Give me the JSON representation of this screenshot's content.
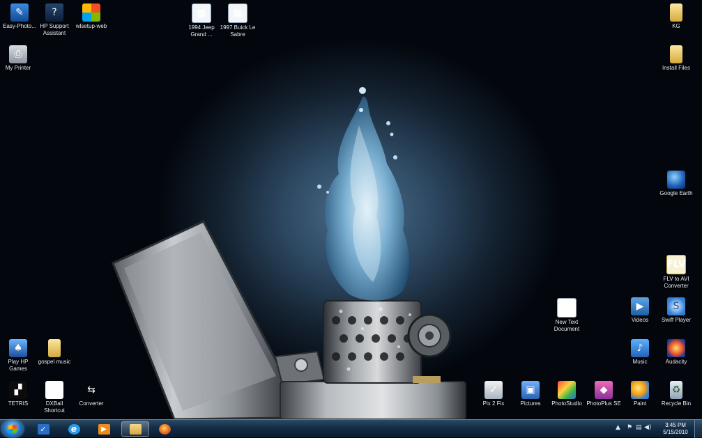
{
  "desktop_icons": [
    {
      "name": "desktop-icon-easy-photo",
      "label": "Easy-Photo...",
      "glyph": "✎",
      "icon": "photo-editor-icon"
    },
    {
      "name": "desktop-icon-hp-support-assistant",
      "label": "HP Support Assistant",
      "glyph": "?",
      "icon": "hp-support-icon"
    },
    {
      "name": "desktop-icon-wlsetup-web",
      "label": "wlsetup-web",
      "glyph": "",
      "icon": "windows-live-icon"
    },
    {
      "name": "desktop-icon-1994-jeep",
      "label": "1994 Jeep Grand ...",
      "glyph": "▦",
      "icon": "spreadsheet-icon"
    },
    {
      "name": "desktop-icon-1997-buick",
      "label": "1997 Buick Le Sabre",
      "glyph": "▦",
      "icon": "spreadsheet-icon"
    },
    {
      "name": "desktop-icon-kg",
      "label": "KG",
      "glyph": "",
      "icon": "folder-icon"
    },
    {
      "name": "desktop-icon-my-printer",
      "label": "My Printer",
      "glyph": "⎙",
      "icon": "printer-icon"
    },
    {
      "name": "desktop-icon-install-files",
      "label": "Install Files",
      "glyph": "",
      "icon": "folder-icon"
    },
    {
      "name": "desktop-icon-google-earth",
      "label": "Google Earth",
      "glyph": "",
      "icon": "globe-icon"
    },
    {
      "name": "desktop-icon-flv-to-avi",
      "label": "FLV to AVI Converter",
      "glyph": "FLV",
      "icon": "flv-converter-icon"
    },
    {
      "name": "desktop-icon-new-text-document",
      "label": "New Text Document",
      "glyph": "≡",
      "icon": "text-document-icon"
    },
    {
      "name": "desktop-icon-videos",
      "label": "Videos",
      "glyph": "▶",
      "icon": "videos-icon"
    },
    {
      "name": "desktop-icon-swiff-player",
      "label": "Swiff Player",
      "glyph": "S",
      "icon": "swiff-player-icon"
    },
    {
      "name": "desktop-icon-play-hp-games",
      "label": "Play HP Games",
      "glyph": "♠",
      "icon": "games-icon"
    },
    {
      "name": "desktop-icon-gospel-music",
      "label": "gospel music",
      "glyph": "",
      "icon": "folder-icon"
    },
    {
      "name": "desktop-icon-music",
      "label": "Music",
      "glyph": "♪",
      "icon": "music-icon"
    },
    {
      "name": "desktop-icon-audacity",
      "label": "Audacity",
      "glyph": "",
      "icon": "audacity-icon"
    },
    {
      "name": "desktop-icon-tetris",
      "label": "TETRIS",
      "glyph": "▞",
      "icon": "tetris-icon"
    },
    {
      "name": "desktop-icon-dxball-shortcut",
      "label": "DXBall Shortcut",
      "glyph": "▤",
      "icon": "dxball-icon"
    },
    {
      "name": "desktop-icon-converter",
      "label": "Converter",
      "glyph": "⇆",
      "icon": "converter-icon"
    },
    {
      "name": "desktop-icon-pix-2-fix",
      "label": "Pix 2 Fix",
      "glyph": "✓",
      "icon": "pix-fix-icon"
    },
    {
      "name": "desktop-icon-pictures",
      "label": "Pictures",
      "glyph": "▣",
      "icon": "pictures-icon"
    },
    {
      "name": "desktop-icon-photostudio",
      "label": "PhotoStudio",
      "glyph": "",
      "icon": "photostudio-icon"
    },
    {
      "name": "desktop-icon-photoplus-se",
      "label": "PhotoPlus SE",
      "glyph": "◆",
      "icon": "photoplus-icon"
    },
    {
      "name": "desktop-icon-paint",
      "label": "Paint",
      "glyph": "",
      "icon": "paint-icon"
    },
    {
      "name": "desktop-icon-recycle-bin",
      "label": "Recycle Bin",
      "glyph": "♻",
      "icon": "recycle-bin-icon"
    }
  ],
  "taskbar": {
    "pinned": [
      {
        "name": "taskbar-hp-support",
        "glyph": "✓",
        "icon": "hp-support-icon",
        "color": "#2b6fc4"
      },
      {
        "name": "taskbar-internet-explorer",
        "glyph": "e",
        "icon": "internet-explorer-icon",
        "color": "#2f9be8"
      },
      {
        "name": "taskbar-media-player",
        "glyph": "▶",
        "icon": "media-player-icon",
        "color": "#f08a1c"
      },
      {
        "name": "taskbar-windows-explorer",
        "glyph": "",
        "icon": "folder-icon",
        "color": "#e9c25a"
      },
      {
        "name": "taskbar-firefox",
        "glyph": "●",
        "icon": "firefox-icon",
        "color": "#e8661f"
      }
    ],
    "tray": {
      "show_hidden_glyph": "▲",
      "action_center_glyph": "⚑",
      "network_glyph": "▤",
      "volume_glyph": "◀)"
    },
    "clock": {
      "time": "3:45 PM",
      "date": "5/15/2010"
    }
  },
  "colors": {
    "taskbar": "#132d45",
    "desktop_background": "#03070d"
  }
}
